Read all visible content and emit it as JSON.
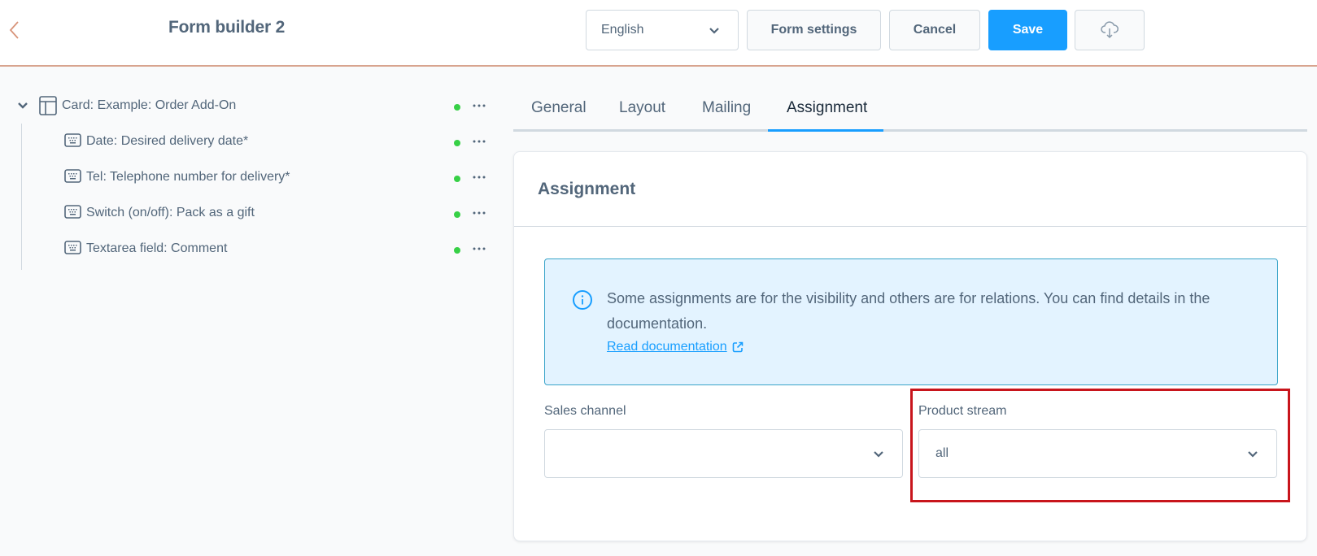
{
  "header": {
    "title": "Form builder 2",
    "language": "English",
    "form_settings_label": "Form settings",
    "cancel_label": "Cancel",
    "save_label": "Save",
    "download_icon": "cloud-download-icon",
    "back_icon": "chevron-left-icon"
  },
  "colors": {
    "primary": "#189eff",
    "text": "#52667a",
    "status_active": "#37d046",
    "header_border": "#d8a48f",
    "highlight": "#c8151c",
    "info_background": "#e3f3ff"
  },
  "tree": {
    "root": {
      "label": "Card: Example: Order Add-On",
      "icon": "layout-card-icon",
      "expanded": true,
      "status": "active"
    },
    "children": [
      {
        "label": "Date: Desired delivery date*",
        "icon": "keyboard-icon",
        "status": "active"
      },
      {
        "label": "Tel: Telephone number for delivery*",
        "icon": "keyboard-icon",
        "status": "active"
      },
      {
        "label": "Switch (on/off): Pack as a gift",
        "icon": "keyboard-icon",
        "status": "active"
      },
      {
        "label": "Textarea field: Comment",
        "icon": "keyboard-icon",
        "status": "active"
      }
    ]
  },
  "tabs": [
    {
      "label": "General",
      "active": false
    },
    {
      "label": "Layout",
      "active": false
    },
    {
      "label": "Mailing",
      "active": false
    },
    {
      "label": "Assignment",
      "active": true
    }
  ],
  "card": {
    "title": "Assignment",
    "alert": {
      "message": "Some assignments are for the visibility and others are for relations. You can find details in the documentation.",
      "link_label": "Read documentation"
    },
    "fields": {
      "sales_channel": {
        "label": "Sales channel",
        "value": ""
      },
      "product_stream": {
        "label": "Product stream",
        "value": "all"
      }
    }
  }
}
